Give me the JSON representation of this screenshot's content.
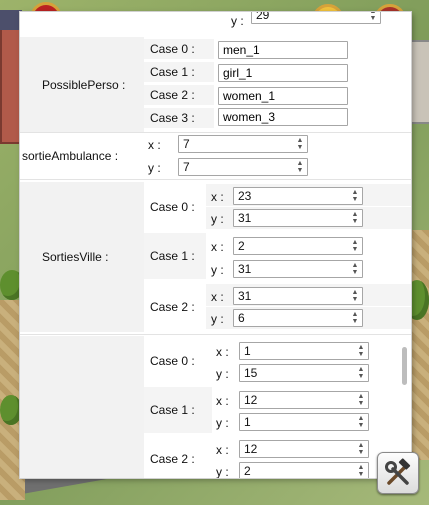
{
  "possible_perso": {
    "label": "PossiblePerso :",
    "cases": [
      {
        "label": "Case 0 :",
        "value": "men_1"
      },
      {
        "label": "Case 1 :",
        "value": "girl_1"
      },
      {
        "label": "Case 2 :",
        "value": "women_1"
      },
      {
        "label": "Case 3 :",
        "value": "women_3"
      }
    ]
  },
  "sortie_ambulance": {
    "label": "sortieAmbulance :",
    "x_label": "x :",
    "x": "7",
    "y_label": "y :",
    "y": "7"
  },
  "sorties_ville": {
    "label": "SortiesVille :",
    "cases": [
      {
        "label": "Case 0 :",
        "x_label": "x :",
        "x": "23",
        "y_label": "y :",
        "y": "31"
      },
      {
        "label": "Case 1 :",
        "x_label": "x :",
        "x": "2",
        "y_label": "y :",
        "y": "31"
      },
      {
        "label": "Case 2 :",
        "x_label": "x :",
        "x": "31",
        "y_label": "y :",
        "y": "6"
      }
    ]
  },
  "fourth_section": {
    "cases": [
      {
        "label": "Case 0 :",
        "x_label": "x :",
        "x": "1",
        "y_label": "y :",
        "y": "15"
      },
      {
        "label": "Case 1 :",
        "x_label": "x :",
        "x": "12",
        "y_label": "y :",
        "y": "1"
      },
      {
        "label": "Case 2 :",
        "x_label": "x :",
        "x": "12",
        "y_label": "y :",
        "y": "2"
      }
    ]
  },
  "top_partial": {
    "y_label": "y :",
    "y": "29"
  },
  "icons": {
    "spin": "spinner-arrows-icon",
    "tools": "hammer-wrench-icon"
  },
  "colors": {
    "label_bg": "#f2f2f2",
    "border": "#a6a6a6",
    "panel": "#ffffff"
  }
}
